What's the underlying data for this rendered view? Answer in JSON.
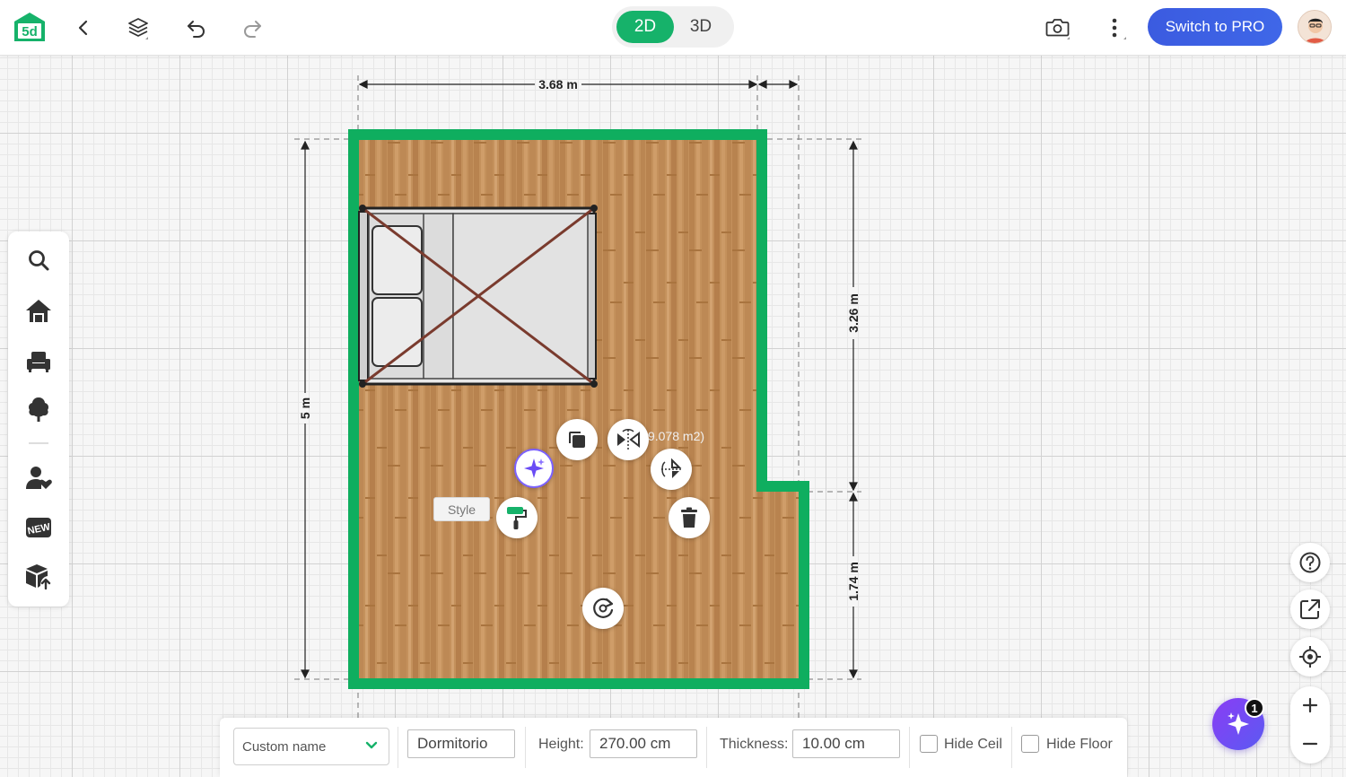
{
  "topbar": {
    "logo_text": "5d",
    "view_2d": "2D",
    "view_3d": "3D",
    "active_view": "2D",
    "pro_button": "Switch to PRO"
  },
  "plan": {
    "dim_top": "3.68 m",
    "dim_left": "5 m",
    "dim_right_upper": "3.26 m",
    "dim_right_lower": "1.74 m",
    "area_text": "9.078 m2)"
  },
  "context_menu": {
    "style_tooltip": "Style"
  },
  "magic": {
    "badge_count": "1"
  },
  "bottombar": {
    "name_select": "Custom name",
    "room_name": "Dormitorio",
    "height_label": "Height:",
    "height_value": "270.00 cm",
    "thickness_label": "Thickness:",
    "thickness_value": "10.00 cm",
    "hide_ceil_label": "Hide Ceil",
    "hide_floor_label": "Hide Floor",
    "hide_ceil_checked": false,
    "hide_floor_checked": false
  },
  "colors": {
    "accent": "#16b26a",
    "wall": "#0fae5f",
    "pro": "#3b5be0",
    "ai": "#7b61ff",
    "floor": "#c4915c"
  },
  "icons": {
    "topbar": [
      "back-icon",
      "layers-icon",
      "undo-icon",
      "redo-icon",
      "camera-icon",
      "more-icon"
    ],
    "sidebar": [
      "search-icon",
      "home-icon",
      "furniture-icon",
      "tree-icon",
      "user-heart-icon",
      "new-icon",
      "box-upload-icon"
    ],
    "actions": [
      "copy-icon",
      "mirror-icon",
      "flip-icon",
      "ai-sparkle-icon",
      "paint-roller-icon",
      "trash-icon",
      "rotate-icon"
    ],
    "right": [
      "help-icon",
      "share-icon",
      "locate-icon",
      "zoom-in-icon",
      "zoom-out-icon"
    ]
  }
}
